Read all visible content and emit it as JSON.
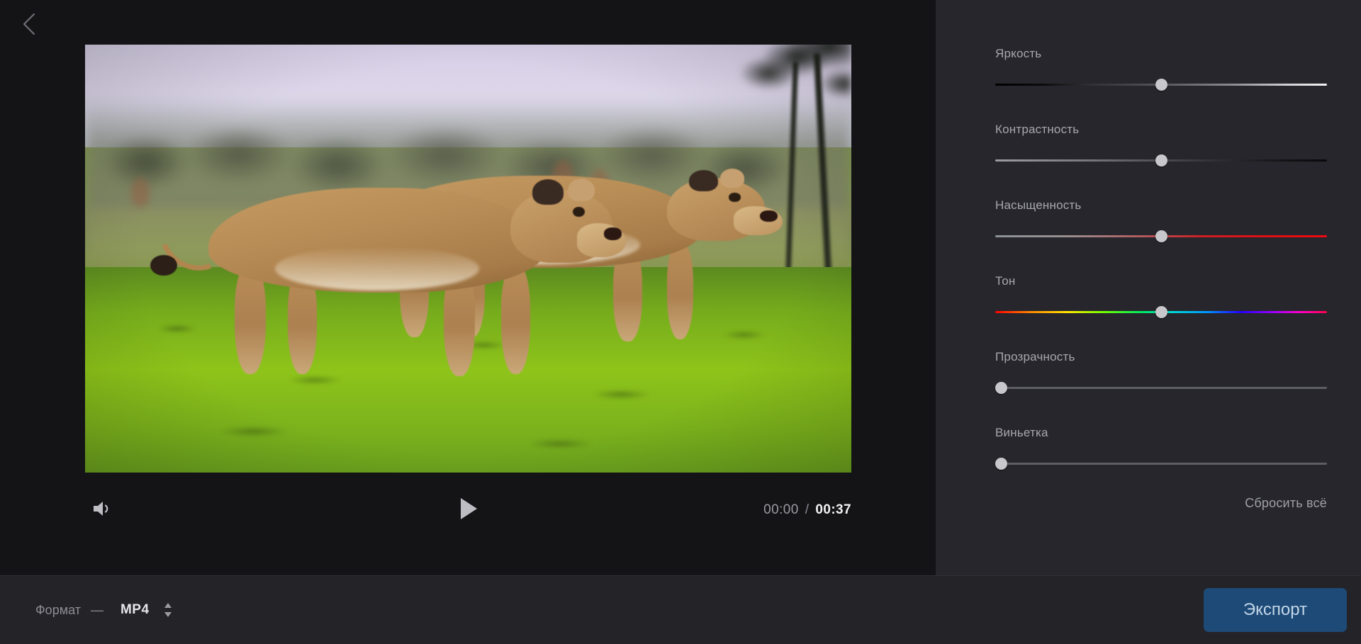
{
  "app": {
    "back_icon": "chevron-left-icon"
  },
  "player": {
    "volume_icon": "volume-on-icon",
    "play_icon": "play-icon",
    "current_time": "00:00",
    "time_separator": "/",
    "total_time": "00:37",
    "scene_description": "Two lionesses walking across bright green grass on a savanna"
  },
  "adjustments": {
    "items": [
      {
        "label": "Яркость",
        "name": "brightness",
        "value": 50,
        "track": "brightness"
      },
      {
        "label": "Контрастность",
        "name": "contrast",
        "value": 50,
        "track": "contrast"
      },
      {
        "label": "Насыщенность",
        "name": "saturation",
        "value": 50,
        "track": "saturation"
      },
      {
        "label": "Тон",
        "name": "hue",
        "value": 50,
        "track": "hue"
      },
      {
        "label": "Прозрачность",
        "name": "transparency",
        "value": 0,
        "track": "plain"
      },
      {
        "label": "Виньетка",
        "name": "vignette",
        "value": 0,
        "track": "plain"
      }
    ],
    "reset_all_label": "Сбросить всё"
  },
  "bottom_bar": {
    "format_label": "Формат",
    "format_dash": "—",
    "format_value": "MP4",
    "stepper_icon": "stepper-up-down-icon",
    "export_label": "Экспорт"
  },
  "colors": {
    "background": "#1a1a1e",
    "player_background": "#141417",
    "panel_background": "#26262c",
    "bottom_bar_background": "#232328",
    "export_button": "#1d4a77",
    "export_text": "#c4d6e8",
    "label_text": "#a7a7ae",
    "thumb": "#c8c8cc"
  }
}
